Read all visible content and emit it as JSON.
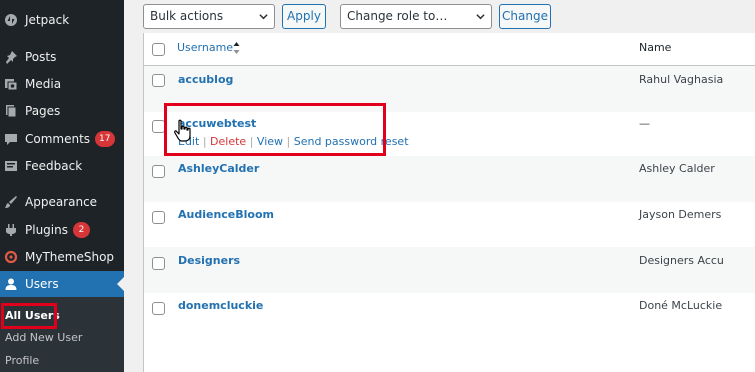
{
  "sidebar": {
    "items": [
      {
        "label": "Jetpack",
        "icon": "jetpack-icon"
      },
      {
        "label": "Posts",
        "icon": "pin-icon"
      },
      {
        "label": "Media",
        "icon": "media-icon"
      },
      {
        "label": "Pages",
        "icon": "pages-icon"
      },
      {
        "label": "Comments",
        "icon": "comment-icon",
        "badge": "17"
      },
      {
        "label": "Feedback",
        "icon": "feedback-icon"
      },
      {
        "label": "Appearance",
        "icon": "paintbrush-icon"
      },
      {
        "label": "Plugins",
        "icon": "plugin-icon",
        "badge": "2"
      },
      {
        "label": "MyThemeShop",
        "icon": "mythemeshop-icon"
      },
      {
        "label": "Users",
        "icon": "users-icon",
        "active": true
      }
    ],
    "submenu": [
      "All Users",
      "Add New User",
      "Profile"
    ]
  },
  "toolbar": {
    "bulk_actions": "Bulk actions",
    "apply": "Apply",
    "change_role": "Change role to…",
    "change": "Change"
  },
  "table": {
    "col_username": "Username",
    "col_name": "Name",
    "rows": [
      {
        "username": "accublog",
        "name": "Rahul Vaghasia"
      },
      {
        "username": "accuwebtest",
        "name": "—",
        "actions": [
          "Edit",
          "Delete",
          "View",
          "Send password reset"
        ]
      },
      {
        "username": "AshleyCalder",
        "name": "Ashley Calder"
      },
      {
        "username": "AudienceBloom",
        "name": "Jayson Demers"
      },
      {
        "username": "Designers",
        "name": "Designers Accu"
      },
      {
        "username": "donemcluckie",
        "name": "Doné McLuckie"
      }
    ]
  },
  "colors": {
    "sidebar_bg": "#1d2327",
    "accent": "#2271b1",
    "highlight": "#e0001b",
    "badge": "#d63638"
  }
}
